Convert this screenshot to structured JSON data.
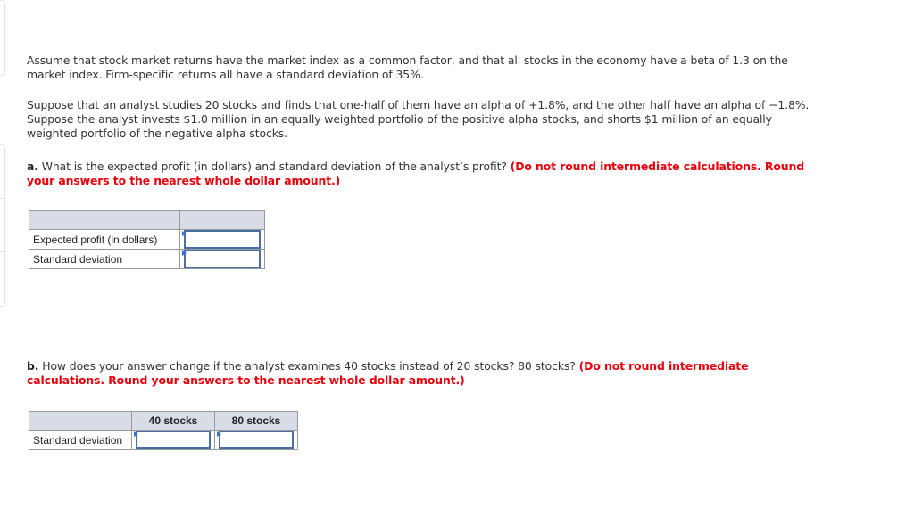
{
  "problem": {
    "intro": "Assume that stock market returns have the market index as a common factor, and that all stocks in the economy have a beta of 1.3 on the market index. Firm-specific returns all have a standard deviation of 35%.",
    "setup": "Suppose that an analyst studies 20 stocks and finds that one-half of them have an alpha of +1.8%, and the other half have an alpha of −1.8%. Suppose the analyst invests $1.0 million in an equally weighted portfolio of the positive alpha stocks, and shorts $1 million of an equally weighted portfolio of the negative alpha stocks."
  },
  "part_a": {
    "label": "a.",
    "question": " What is the expected profit (in dollars) and standard deviation of the analyst’s profit? ",
    "instruction": "(Do not round intermediate calculations. Round your answers to the nearest whole dollar amount.)",
    "table": {
      "headers": [
        "",
        ""
      ],
      "rows": [
        {
          "label": "Expected profit (in dollars)",
          "value": ""
        },
        {
          "label": "Standard deviation",
          "value": ""
        }
      ]
    }
  },
  "part_b": {
    "label": "b.",
    "question": " How does your answer change if the analyst examines 40 stocks instead of 20 stocks? 80 stocks? ",
    "instruction": "(Do not round intermediate calculations. Round your answers to the nearest whole dollar amount.)",
    "table": {
      "headers": [
        "",
        "40 stocks",
        "80 stocks"
      ],
      "rows": [
        {
          "label": "Standard deviation",
          "values": [
            "",
            ""
          ]
        }
      ]
    }
  }
}
